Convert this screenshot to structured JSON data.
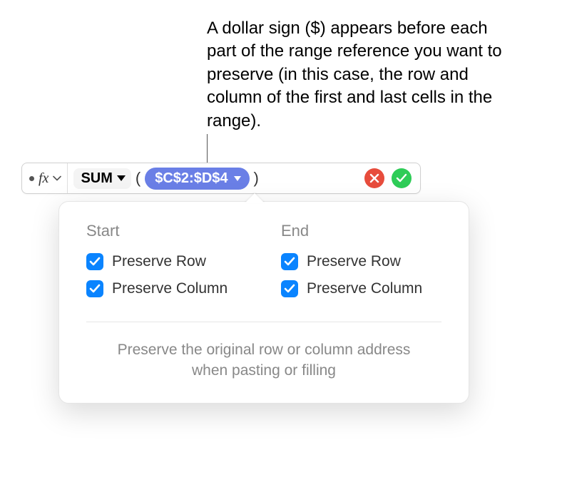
{
  "annotation": "A dollar sign ($) appears before each part of the range reference you want to preserve (in this case, the row and column of the first and last cells in the range).",
  "formula_bar": {
    "fx_label": "fx",
    "function_name": "SUM",
    "open_paren": "(",
    "range_reference": "$C$2:$D$4",
    "close_paren": ")"
  },
  "popover": {
    "start": {
      "heading": "Start",
      "preserve_row": "Preserve Row",
      "preserve_column": "Preserve Column"
    },
    "end": {
      "heading": "End",
      "preserve_row": "Preserve Row",
      "preserve_column": "Preserve Column"
    },
    "description": "Preserve the original row or column address when pasting or filling"
  }
}
